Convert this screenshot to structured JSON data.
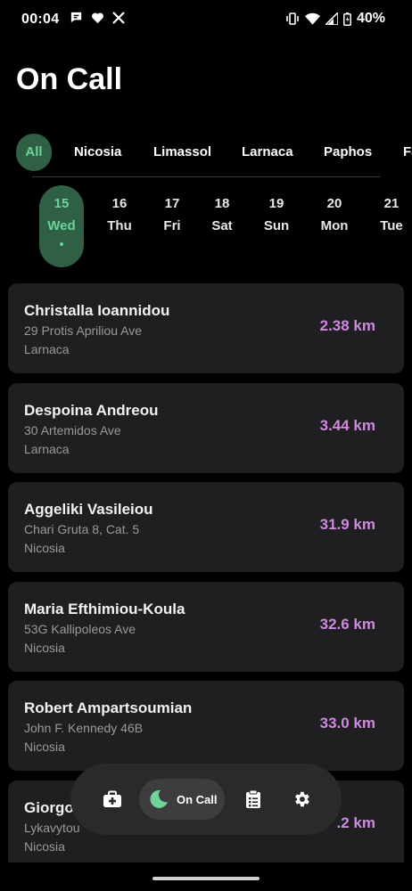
{
  "status_bar": {
    "time": "00:04",
    "battery": "40%",
    "left_icons": [
      "message-icon",
      "heart-icon",
      "x-logo-icon"
    ],
    "right_icons": [
      "vibrate-icon",
      "wifi-icon",
      "signal-icon",
      "battery-icon"
    ]
  },
  "page": {
    "title": "On Call"
  },
  "filters": [
    "All",
    "Nicosia",
    "Limassol",
    "Larnaca",
    "Paphos",
    "Fa"
  ],
  "active_filter": "All",
  "days": [
    {
      "num": "15",
      "name": "Wed",
      "active": true
    },
    {
      "num": "16",
      "name": "Thu"
    },
    {
      "num": "17",
      "name": "Fri"
    },
    {
      "num": "18",
      "name": "Sat"
    },
    {
      "num": "19",
      "name": "Sun"
    },
    {
      "num": "20",
      "name": "Mon"
    },
    {
      "num": "21",
      "name": "Tue"
    }
  ],
  "pharmacies": [
    {
      "name": "Christalla Ioannidou",
      "street": "29 Protis Apriliou Ave",
      "city": "Larnaca",
      "distance": "2.38 km"
    },
    {
      "name": "Despoina Andreou",
      "street": "30 Artemidos Ave",
      "city": "Larnaca",
      "distance": "3.44 km"
    },
    {
      "name": "Aggeliki Vasileiou",
      "street": "Chari Gruta 8, Cat. 5",
      "city": "Nicosia",
      "distance": "31.9 km"
    },
    {
      "name": "Maria Efthimiou-Koula",
      "street": "53G Kallipoleos Ave",
      "city": "Nicosia",
      "distance": "32.6 km"
    },
    {
      "name": "Robert Ampartsoumian",
      "street": "John F. Kennedy 46B",
      "city": "Nicosia",
      "distance": "33.0 km"
    },
    {
      "name": "Giorgo",
      "street": "Lykavytou",
      "city": "Nicosia",
      "distance": ".2 km"
    }
  ],
  "bottom_nav": {
    "items": [
      "pharmacy-icon",
      "on-call-icon",
      "clipboard-icon",
      "gear-icon"
    ],
    "active_label": "On Call"
  },
  "colors": {
    "background": "#000000",
    "card": "#1f1e20",
    "accent_green": "#6fd39a",
    "accent_green_bg": "#2f5f44",
    "distance": "#cf8ae0"
  }
}
